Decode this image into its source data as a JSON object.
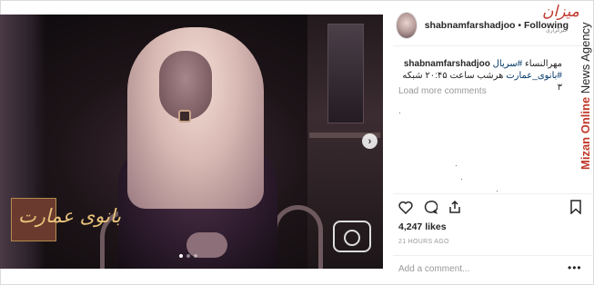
{
  "post": {
    "username": "shabnamfarshadjoo",
    "separator": "•",
    "follow_state": "Following",
    "caption": {
      "username": "shabnamfarshadjoo",
      "text_line1": "مهرالنساء",
      "hashtag1": "#سریال",
      "hashtag2": "#بانوی_عمارت",
      "text_line2": "هرشب ساعت ۲۰:۴۵ شبکه ۳"
    },
    "load_more_comments": "Load more comments",
    "likes": "4,247 likes",
    "time_ago": "21 HOURS AGO",
    "comment_placeholder": "Add a comment...",
    "more_options": "•••"
  },
  "carousel": {
    "next_arrow": "›",
    "slide_count": 3,
    "active_slide": 1
  },
  "photo": {
    "title_logo_text": "بانوی عمارت"
  },
  "watermark": {
    "brand_logo": "میزان",
    "brand_logo_sub": "خبرگزاری",
    "brand_online": "Mizan Online",
    "brand_agency": "News Agency"
  },
  "icons": {
    "like": "heart-icon",
    "comment": "comment-icon",
    "share": "share-icon",
    "save": "bookmark-icon",
    "next": "chevron-right-icon"
  }
}
